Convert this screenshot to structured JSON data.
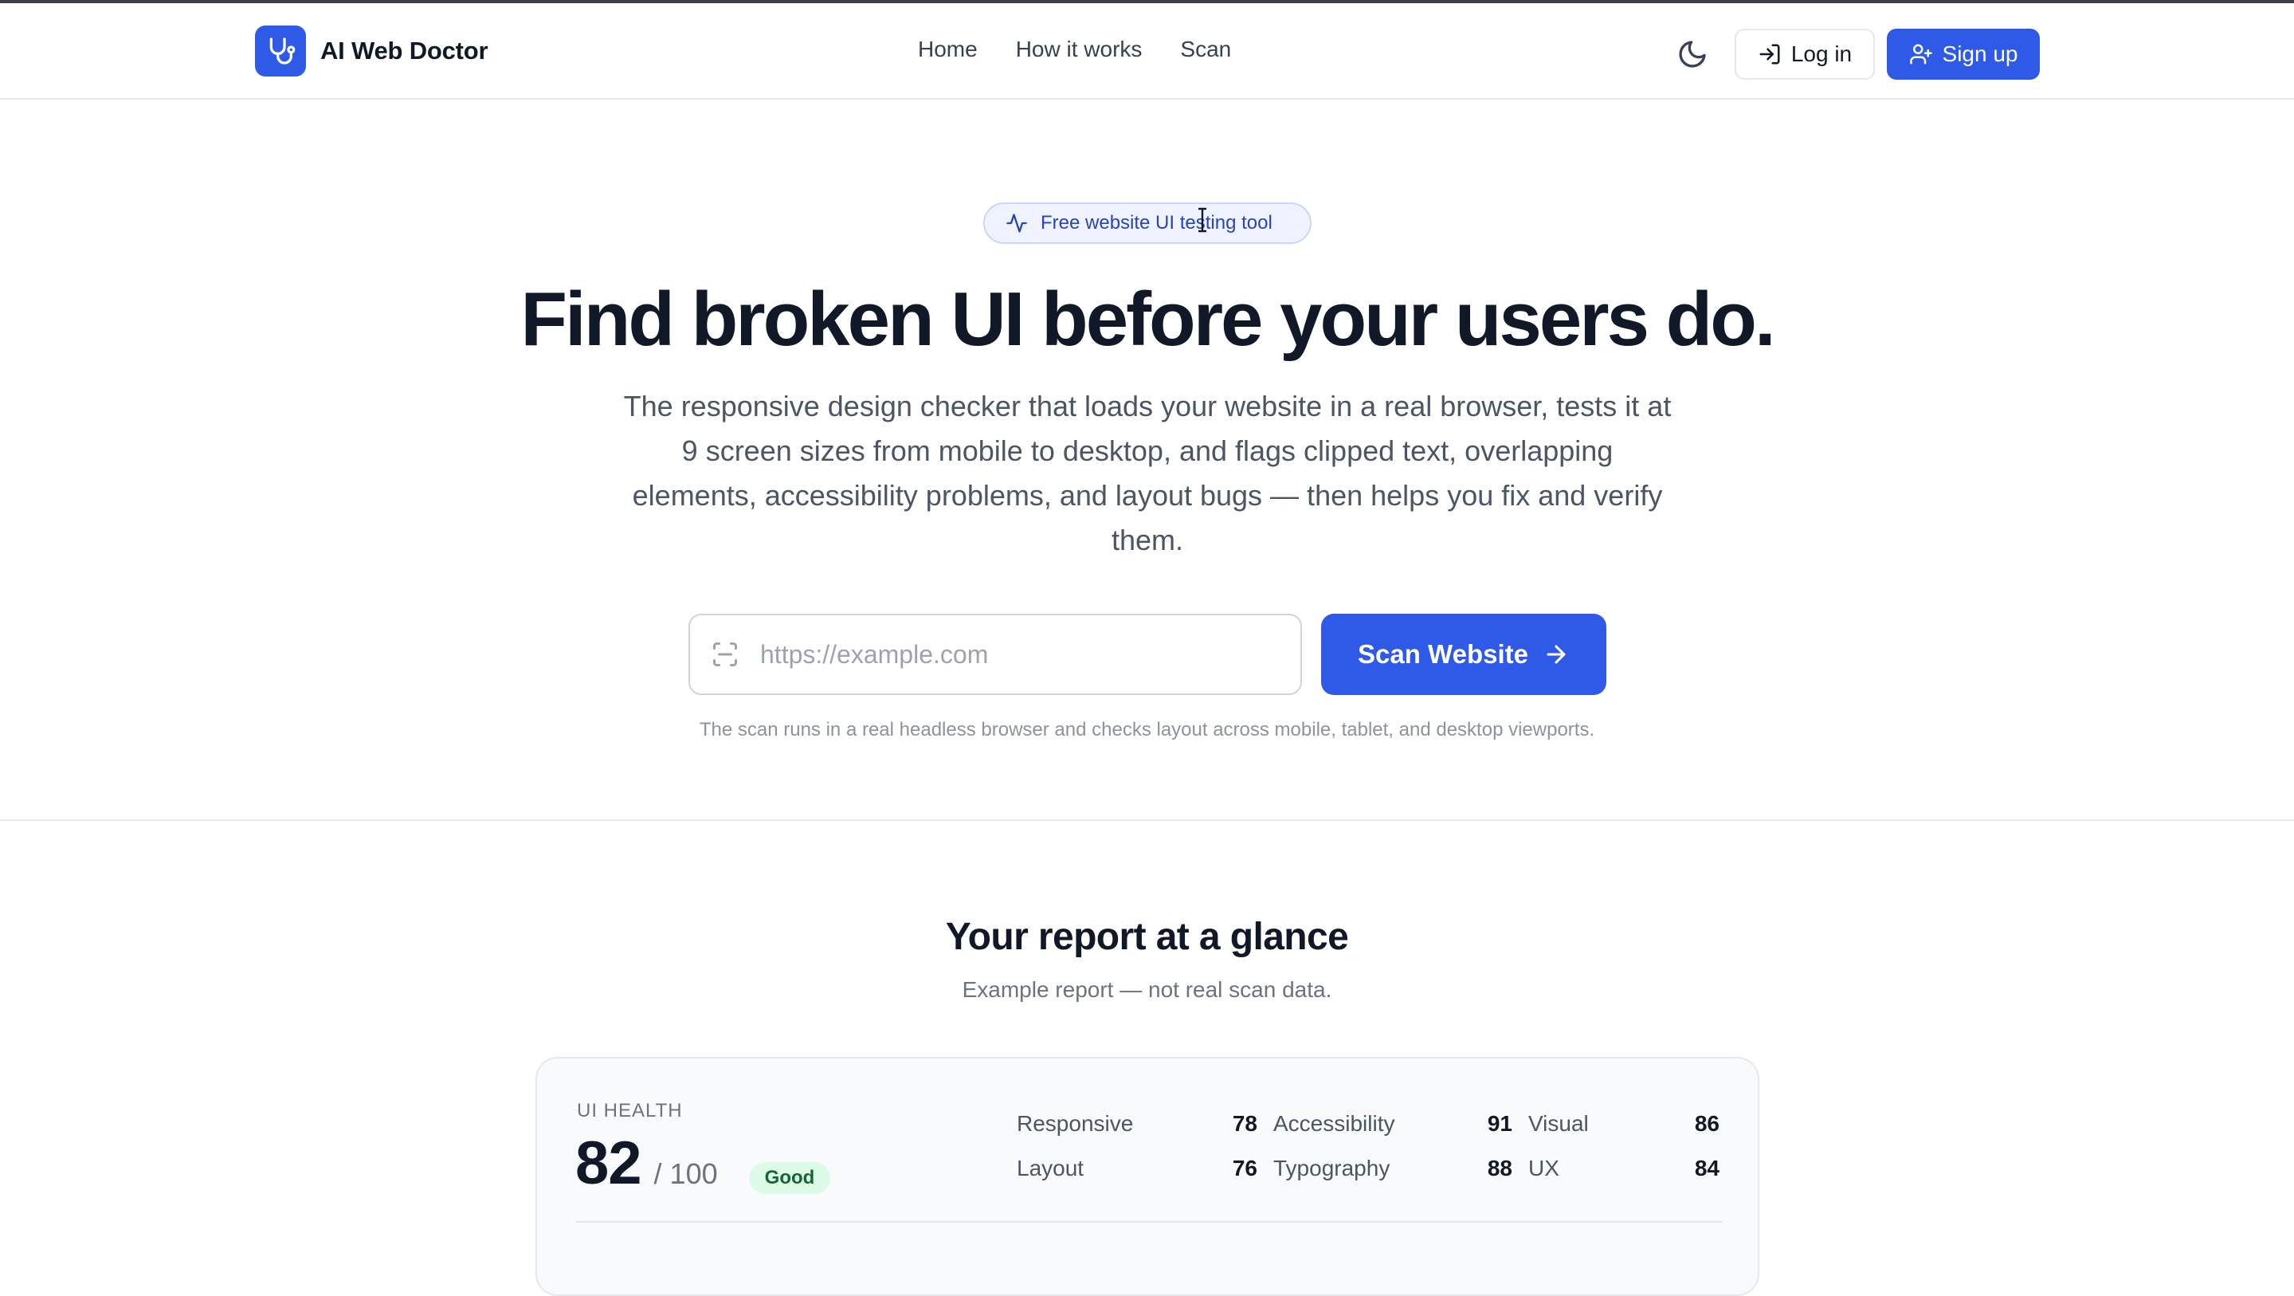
{
  "header": {
    "brand": "AI Web Doctor",
    "nav": [
      "Home",
      "How it works",
      "Scan"
    ],
    "login_label": "Log in",
    "signup_label": "Sign up"
  },
  "hero": {
    "pill": "Free website UI testing tool",
    "headline": "Find broken UI before your users do.",
    "subtitle": "The responsive design checker that loads your website in a real browser, tests it at 9 screen sizes from mobile to desktop, and flags clipped text, overlapping elements, accessibility problems, and layout bugs — then helps you fix and verify them.",
    "url_placeholder": "https://example.com",
    "url_value": "",
    "scan_label": "Scan Website",
    "note": "The scan runs in a real headless browser and checks layout across mobile, tablet, and desktop viewports."
  },
  "report": {
    "title": "Your report at a glance",
    "subtitle": "Example report — not real scan data.",
    "health_label": "UI HEALTH",
    "score": "82",
    "score_max": "/ 100",
    "status": "Good",
    "metrics": [
      {
        "label": "Responsive",
        "value": "78"
      },
      {
        "label": "Accessibility",
        "value": "91"
      },
      {
        "label": "Visual",
        "value": "86"
      },
      {
        "label": "Layout",
        "value": "76"
      },
      {
        "label": "Typography",
        "value": "88"
      },
      {
        "label": "UX",
        "value": "84"
      }
    ]
  },
  "colors": {
    "accent": "#2f5ae8",
    "status_good_bg": "#dcfce7",
    "status_good_text": "#166534"
  },
  "icons": [
    "stethoscope-icon",
    "moon-icon",
    "log-in-icon",
    "user-plus-icon",
    "activity-icon",
    "scan-icon",
    "arrow-right-icon"
  ]
}
